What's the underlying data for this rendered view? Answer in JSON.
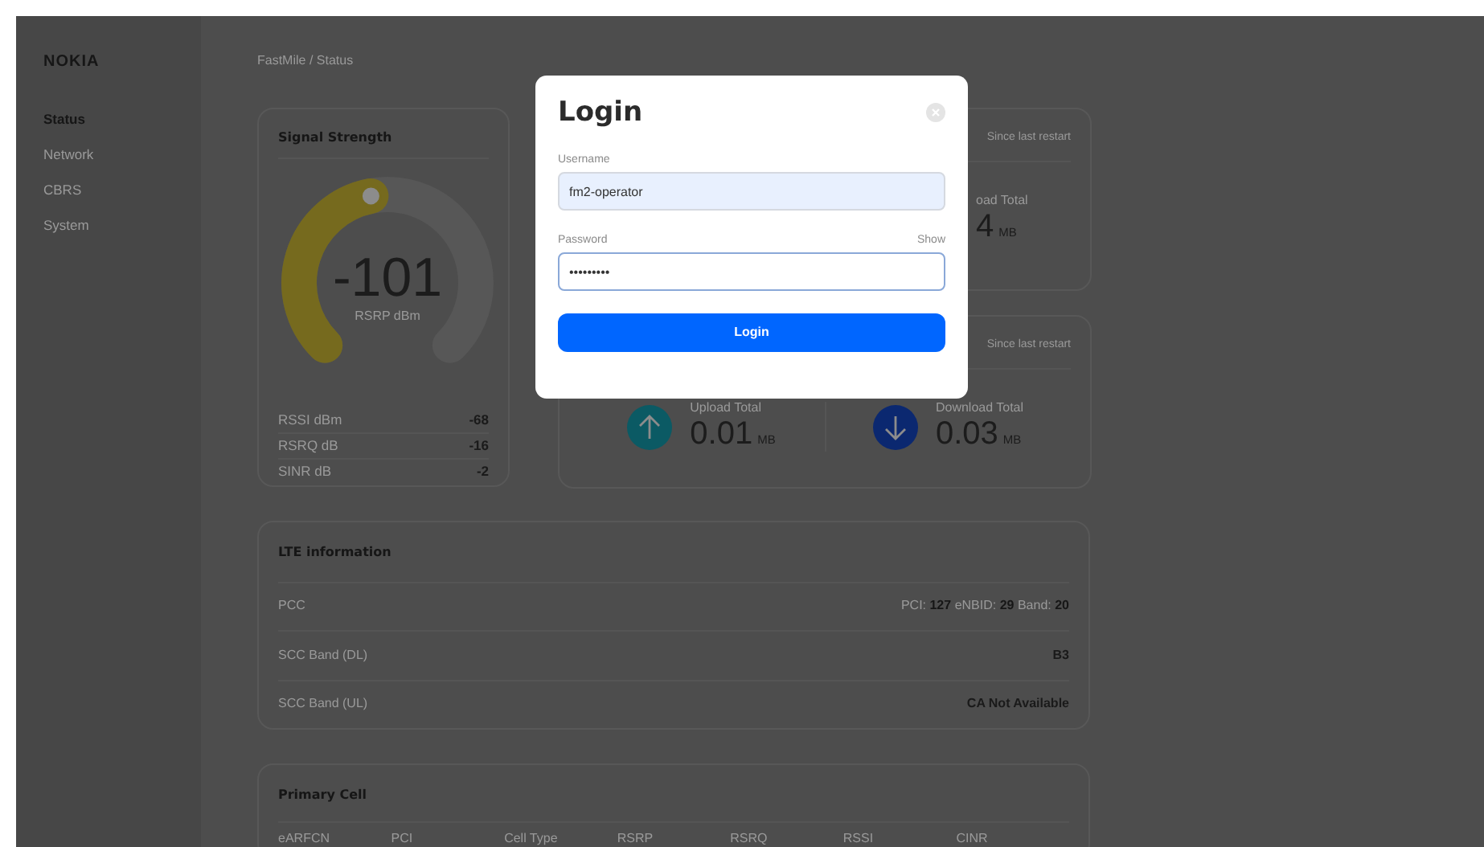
{
  "sidebar": {
    "logo": "NOKIA",
    "items": [
      {
        "label": "Status",
        "selected": true
      },
      {
        "label": "Network",
        "selected": false
      },
      {
        "label": "CBRS",
        "selected": false
      },
      {
        "label": "System",
        "selected": false
      }
    ]
  },
  "breadcrumb": "FastMile / Status",
  "signal_strength": {
    "title": "Signal Strength",
    "gauge": {
      "value": "-101",
      "unit": "RSRP dBm",
      "level": 0.46
    },
    "stats": [
      {
        "label": "RSSI dBm",
        "value": "-68"
      },
      {
        "label": "RSRQ dB",
        "value": "-16"
      },
      {
        "label": "SINR dB",
        "value": "-2"
      }
    ]
  },
  "traffic_cards": [
    {
      "note": "Since last restart",
      "columns": [
        {
          "kind": "clipped",
          "label": "oad Total",
          "value": "4",
          "unit": "MB"
        }
      ]
    },
    {
      "note": "Since last restart",
      "columns": [
        {
          "kind": "upload",
          "label": "Upload Total",
          "value": "0.01",
          "unit": "MB"
        },
        {
          "kind": "download",
          "label": "Download Total",
          "value": "0.03",
          "unit": "MB"
        }
      ]
    }
  ],
  "lte_information": {
    "title": "LTE information",
    "rows": [
      {
        "label": "PCC",
        "kind": "mixed",
        "value": "PCI: **127** eNBID: **29** Band: **20**"
      },
      {
        "label": "SCC Band (DL)",
        "kind": "bold",
        "value": "B3"
      },
      {
        "label": "SCC Band (UL)",
        "kind": "bold",
        "value": "CA Not Available"
      }
    ]
  },
  "primary_cell": {
    "title": "Primary Cell",
    "columns": [
      "eARFCN",
      "PCI",
      "Cell Type",
      "RSRP",
      "RSRQ",
      "RSSI",
      "CINR"
    ]
  },
  "login_dialog": {
    "title": "Login",
    "fields": [
      {
        "kind": "text",
        "label": "Username",
        "value": "fm2-operator"
      },
      {
        "kind": "password",
        "label": "Password",
        "value": "•••••••••",
        "action": "Show"
      }
    ],
    "button": "Login"
  }
}
